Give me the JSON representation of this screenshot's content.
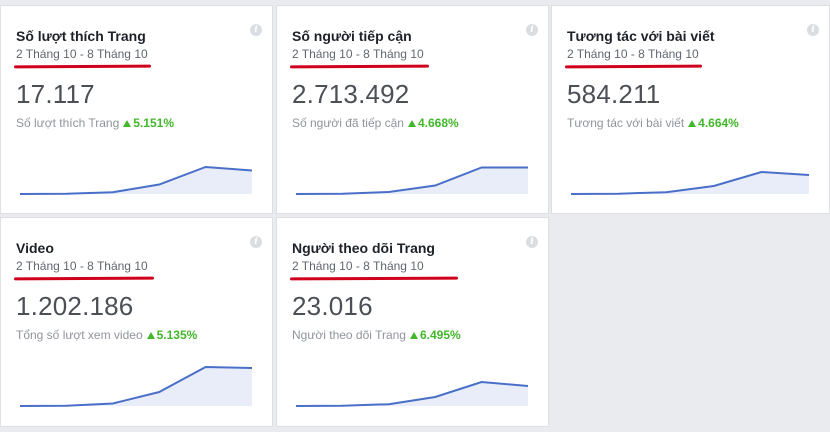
{
  "cards": [
    {
      "title": "Số lượt thích Trang",
      "date_range": "2 Tháng 10 - 8 Tháng 10",
      "value": "17.117",
      "label": "Số lượt thích Trang",
      "change": "5.151%",
      "info_icon": "info-icon",
      "sparkline": [
        0,
        0.3,
        1.8,
        9.5,
        27,
        23.5
      ]
    },
    {
      "title": "Số người tiếp cận",
      "date_range": "2 Tháng 10 - 8 Tháng 10",
      "value": "2.713.492",
      "label": "Số người đã tiếp cận",
      "change": "4.668%",
      "info_icon": "info-icon",
      "sparkline": [
        0,
        0.3,
        2,
        8.5,
        26.5,
        26.5
      ]
    },
    {
      "title": "Tương tác với bài viết",
      "date_range": "2 Tháng 10 - 8 Tháng 10",
      "value": "584.211",
      "label": "Tương tác với bài viết",
      "change": "4.664%",
      "info_icon": "info-icon",
      "sparkline": [
        0,
        0.3,
        1.8,
        8,
        22,
        19
      ]
    },
    {
      "title": "Video",
      "date_range": "2 Tháng 10 - 8 Tháng 10",
      "value": "1.202.186",
      "label": "Tổng số lượt xem video",
      "change": "5.135%",
      "info_icon": "info-icon",
      "sparkline": [
        0,
        0.3,
        2.5,
        14,
        39,
        38
      ]
    },
    {
      "title": "Người theo dõi Trang",
      "date_range": "2 Tháng 10 - 8 Tháng 10",
      "value": "23.016",
      "label": "Người theo dõi Trang",
      "change": "6.495%",
      "info_icon": "info-icon",
      "sparkline": [
        0,
        0.3,
        1.8,
        9,
        24,
        20
      ]
    }
  ],
  "colors": {
    "line": "#4a6fc8",
    "fill": "#e8edf9",
    "positive": "#42b72a",
    "underline": "#d0021b"
  }
}
